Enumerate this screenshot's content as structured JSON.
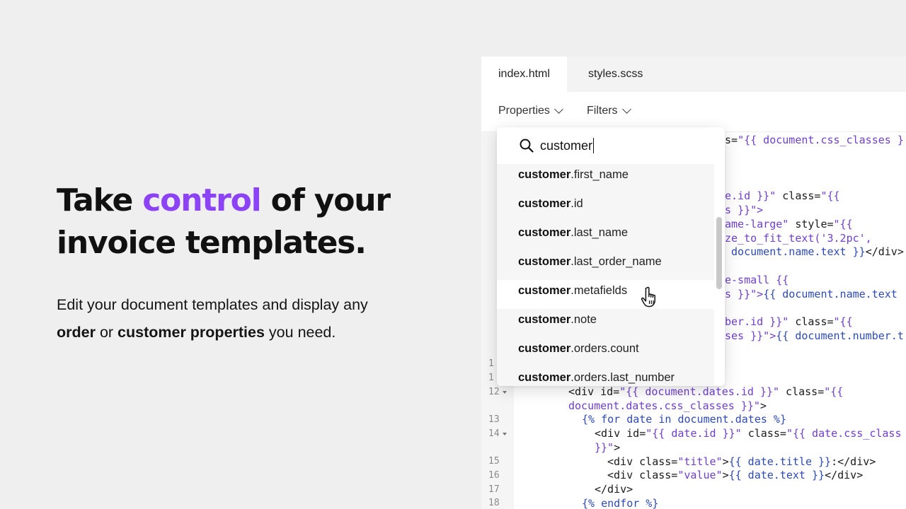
{
  "hero": {
    "title_pre": "Take ",
    "title_accent": "control",
    "title_post": " of your",
    "title_line2": "invoice templates.",
    "desc_1": "Edit your document templates and display any",
    "desc_bold1": "order",
    "desc_or": " or ",
    "desc_bold2": "customer properties",
    "desc_end": " you need.",
    "accent_color": "#8b43f5"
  },
  "editor": {
    "tabs": [
      {
        "label": "index.html",
        "active": true
      },
      {
        "label": "styles.scss",
        "active": false
      }
    ],
    "toolbar": {
      "properties_label": "Properties",
      "filters_label": "Filters"
    },
    "line_numbers": [
      "1",
      "1",
      "12",
      "13",
      "14",
      "15",
      "16",
      "17",
      "18"
    ],
    "code_fragments": {
      "f1a": "s=",
      "f1b": "\"{{ document.css_classes }",
      "f2a": "e.id }}\"",
      "f2b": " class=",
      "f2c": "\"{{",
      "f3": "s }}\">",
      "f4a": "ame-large\"",
      "f4b": " style=",
      "f4c": "\"{{",
      "f5": "ze_to_fit_text('3.2pc',",
      "f6a": " document.name.text }}",
      "f6b": "</div>",
      "f7": "e-small {{",
      "f8a": "s }}\">",
      "f8b": "{{ document.name.text",
      "f9a": "ber.id }}\"",
      "f9b": " class=",
      "f9c": "\"{{",
      "f10a": "ses }}\">",
      "f10b": "{{ document.number.t",
      "l12a": "<div id=",
      "l12b": "\"{{ document.dates.id }}\"",
      "l12c": " class=",
      "l12d": "\"{{",
      "l12e": "document.dates.css_classes }}\"",
      "l12f": ">",
      "l13": "{% for date in document.dates %}",
      "l14a": "<div id=",
      "l14b": "\"{{ date.id }}\"",
      "l14c": " class=",
      "l14d": "\"{{ date.css_class",
      "l14e": "}}\"",
      "l14f": ">",
      "l15a": "<div class=",
      "l15b": "\"title\"",
      "l15c": ">",
      "l15d": "{{ date.title }}",
      "l15e": ":</div>",
      "l16a": "<div class=",
      "l16b": "\"value\"",
      "l16c": ">",
      "l16d": "{{ date.text }}",
      "l16e": "</div>",
      "l17": "</div>",
      "l18": "{% endfor %}"
    }
  },
  "dropdown": {
    "search_value": "customer",
    "items": [
      {
        "bold": "customer",
        "rest": ".first_name"
      },
      {
        "bold": "customer",
        "rest": ".id"
      },
      {
        "bold": "customer",
        "rest": ".last_name"
      },
      {
        "bold": "customer",
        "rest": ".last_order_name"
      },
      {
        "bold": "customer",
        "rest": ".metafields"
      },
      {
        "bold": "customer",
        "rest": ".note"
      },
      {
        "bold": "customer",
        "rest": ".orders.count"
      },
      {
        "bold": "customer",
        "rest": ".orders.last_number"
      }
    ],
    "hovered_index": 4
  }
}
